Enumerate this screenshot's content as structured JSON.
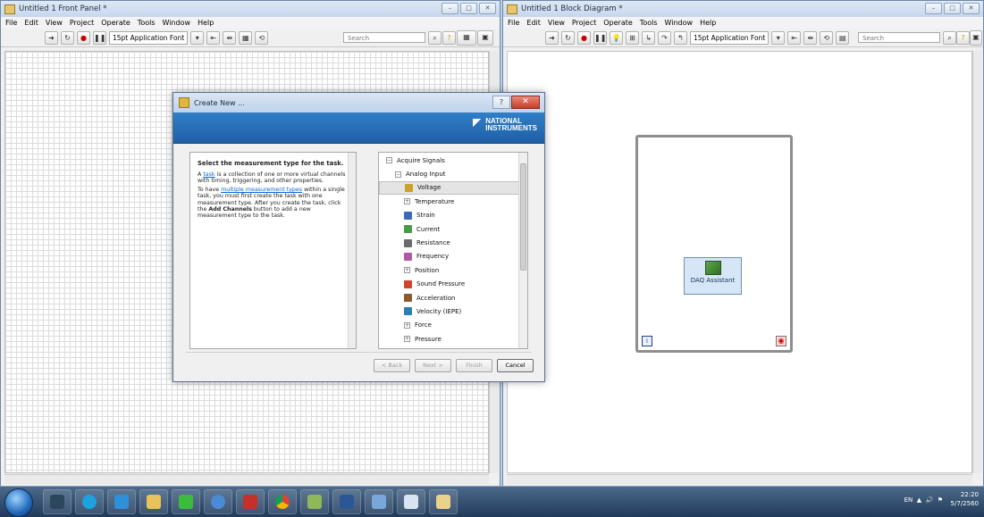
{
  "front_panel": {
    "title": "Untitled 1 Front Panel *",
    "menu": [
      "File",
      "Edit",
      "View",
      "Project",
      "Operate",
      "Tools",
      "Window",
      "Help"
    ],
    "font_select": "15pt Application Font",
    "search_placeholder": "Search"
  },
  "block_diagram": {
    "title": "Untitled 1 Block Diagram *",
    "menu": [
      "File",
      "Edit",
      "View",
      "Project",
      "Operate",
      "Tools",
      "Window",
      "Help"
    ],
    "font_select": "15pt Application Font",
    "search_placeholder": "Search",
    "daq_label": "DAQ Assistant",
    "iteration_terminal": "i"
  },
  "dialog": {
    "title": "Create New ...",
    "logo_line1": "NATIONAL",
    "logo_line2": "INSTRUMENTS",
    "description": {
      "heading": "Select the measurement type for the task.",
      "p1_link": "task",
      "p1_pre": "A ",
      "p1_post": " is a collection of one or more virtual channels with timing, triggering, and other properties.",
      "p2_pre": "To have ",
      "p2_link": "multiple measurement types",
      "p2_mid": " within a single task, you must first create the task with one measurement type. After you create the task, click the ",
      "p2_bold": "Add Channels",
      "p2_post": " button to add a new measurement type to the task."
    },
    "tree": [
      {
        "label": "Acquire Signals",
        "indent": 0,
        "toggle": "⊟",
        "icon": ""
      },
      {
        "label": "Analog Input",
        "indent": 1,
        "toggle": "⊟",
        "icon": ""
      },
      {
        "label": "Voltage",
        "indent": 2,
        "toggle": "",
        "icon": "voltage",
        "selected": true
      },
      {
        "label": "Temperature",
        "indent": 2,
        "toggle": "⊞",
        "icon": ""
      },
      {
        "label": "Strain",
        "indent": 2,
        "toggle": "",
        "icon": "strain"
      },
      {
        "label": "Current",
        "indent": 2,
        "toggle": "",
        "icon": "current"
      },
      {
        "label": "Resistance",
        "indent": 2,
        "toggle": "",
        "icon": "resistance"
      },
      {
        "label": "Frequency",
        "indent": 2,
        "toggle": "",
        "icon": "frequency"
      },
      {
        "label": "Position",
        "indent": 2,
        "toggle": "⊞",
        "icon": ""
      },
      {
        "label": "Sound Pressure",
        "indent": 2,
        "toggle": "",
        "icon": "sound-pressure"
      },
      {
        "label": "Acceleration",
        "indent": 2,
        "toggle": "",
        "icon": "acceleration"
      },
      {
        "label": "Velocity (IEPE)",
        "indent": 2,
        "toggle": "",
        "icon": "velocity"
      },
      {
        "label": "Force",
        "indent": 2,
        "toggle": "⊞",
        "icon": ""
      },
      {
        "label": "Pressure",
        "indent": 2,
        "toggle": "⊞",
        "icon": ""
      }
    ],
    "buttons": {
      "back": "< Back",
      "next": "Next >",
      "finish": "Finish",
      "cancel": "Cancel"
    }
  },
  "taskbar": {
    "language": "EN",
    "time": "22:20",
    "date": "5/7/2560"
  },
  "colors": {
    "ni_blue": "#1f5fa6",
    "taskbar": "#203a5b"
  }
}
